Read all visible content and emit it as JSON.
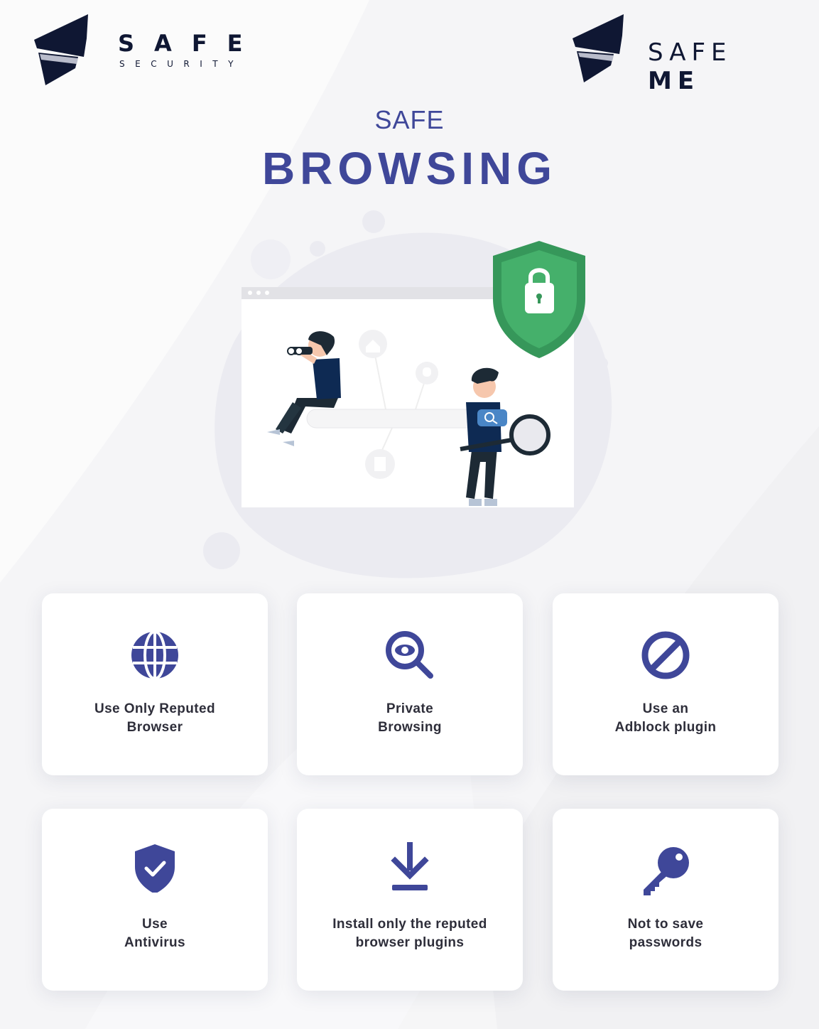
{
  "brand_left": {
    "name": "SAFE",
    "tagline": "SECURITY"
  },
  "brand_right": {
    "name_light": "SAFE",
    "name_bold": "ME"
  },
  "heading": {
    "top": "SAFE",
    "main": "BROWSING"
  },
  "colors": {
    "primary": "#3f4799",
    "navy": "#0f1733",
    "shield_green": "#45b06b",
    "shield_dark_green": "#36975a",
    "text": "#2e2e3a"
  },
  "tips": [
    {
      "icon": "globe-icon",
      "line1": "Use Only Reputed",
      "line2": "Browser"
    },
    {
      "icon": "eye-search-icon",
      "line1": "Private",
      "line2": "Browsing"
    },
    {
      "icon": "block-icon",
      "line1": "Use an",
      "line2": "Adblock plugin"
    },
    {
      "icon": "shield-check-icon",
      "line1": "Use",
      "line2": "Antivirus"
    },
    {
      "icon": "download-icon",
      "line1": "Install only the reputed",
      "line2": "browser plugins"
    },
    {
      "icon": "key-icon",
      "line1": "Not to save",
      "line2": "passwords"
    }
  ]
}
